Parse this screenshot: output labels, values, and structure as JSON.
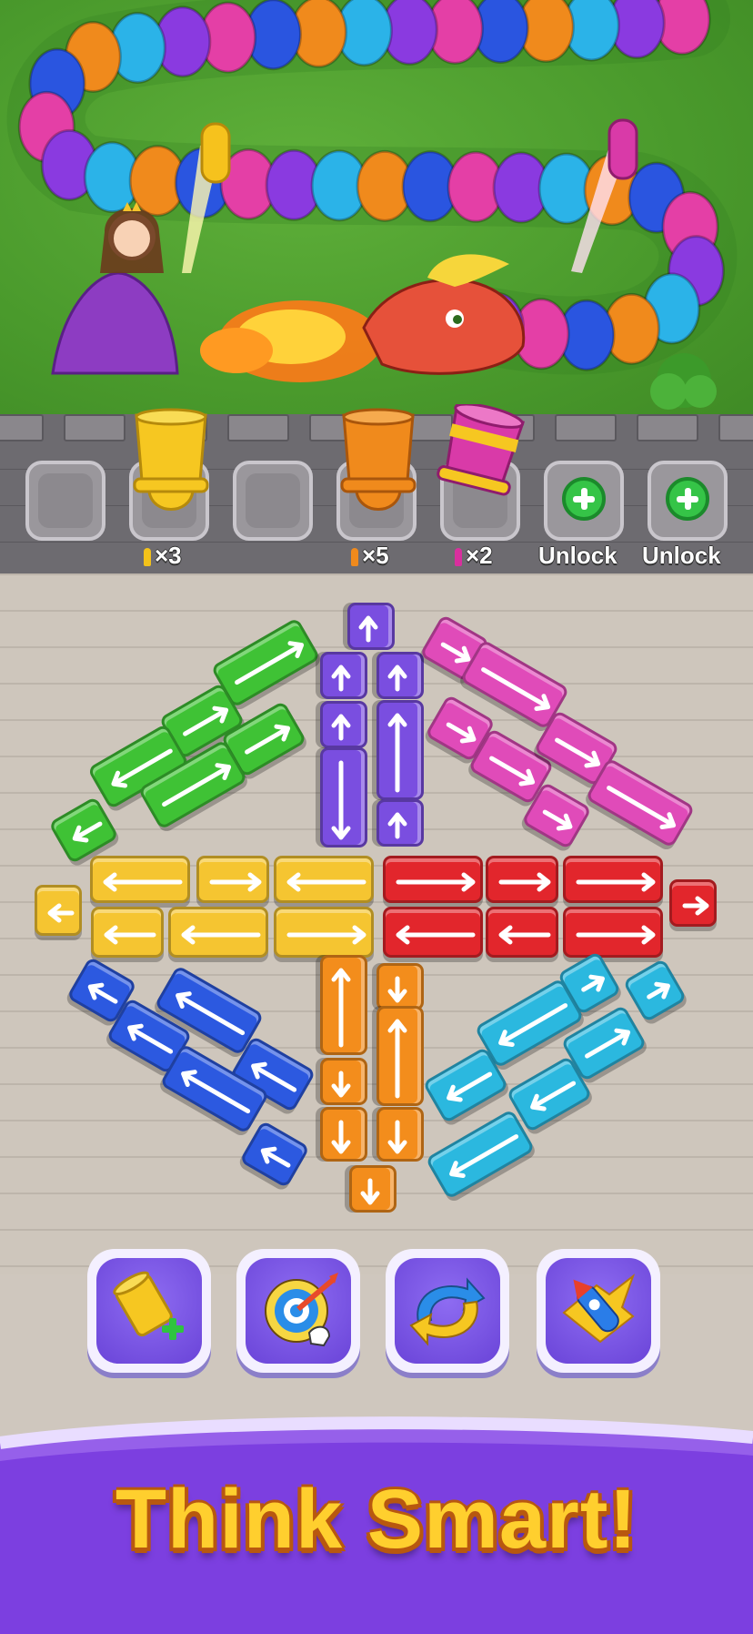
{
  "scene": {
    "slots": [
      {
        "id": "slot-1",
        "state": "empty"
      },
      {
        "id": "slot-2",
        "state": "cannon",
        "color": "yellow",
        "ammo_label": "×3",
        "ammo_color": "#f3c21a"
      },
      {
        "id": "slot-3",
        "state": "empty"
      },
      {
        "id": "slot-4",
        "state": "cannon",
        "color": "orange",
        "ammo_label": "×5",
        "ammo_color": "#f08a1c"
      },
      {
        "id": "slot-5",
        "state": "cannon",
        "color": "magenta",
        "ammo_label": "×2",
        "ammo_color": "#d92f9e"
      },
      {
        "id": "slot-6",
        "state": "locked",
        "label": "Unlock"
      },
      {
        "id": "slot-7",
        "state": "locked",
        "label": "Unlock"
      }
    ],
    "characters": [
      "princess-icon",
      "dragon-icon",
      "bush-icon"
    ],
    "colors": {
      "green": "#3fc235",
      "purple": "#7a4ee0",
      "magenta": "#e04bb9",
      "yellow": "#f5c531",
      "red": "#e2262c",
      "blue": "#2c59e0",
      "orange": "#f38d1c",
      "cyan": "#2bb8df"
    }
  },
  "boosters": [
    {
      "name": "add-cannon-booster",
      "icon": "cannon-plus-icon"
    },
    {
      "name": "target-booster",
      "icon": "target-arrow-icon"
    },
    {
      "name": "shuffle-booster",
      "icon": "shuffle-icon"
    },
    {
      "name": "rocket-booster",
      "icon": "rocket-icon"
    }
  ],
  "banner": {
    "title": "Think Smart!"
  }
}
